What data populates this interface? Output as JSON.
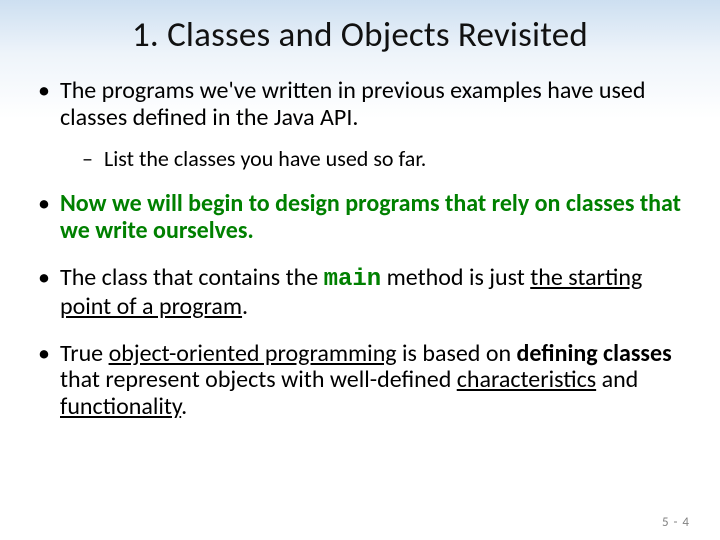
{
  "slide": {
    "title": "1. Classes and Objects Revisited",
    "bullets": {
      "b1": {
        "text": "The programs we've written in previous examples have used classes defined in the Java API.",
        "sub1": "List the classes you have used so far."
      },
      "b2": {
        "text": "Now we will begin to design programs that rely on classes that we write ourselves."
      },
      "b3": {
        "pre": "The class that contains the ",
        "code": "main",
        "mid": " method is just ",
        "u1": "the starting point of a program",
        "post": "."
      },
      "b4": {
        "t1": "True ",
        "u1": "object-oriented programming",
        "t2": " is based on ",
        "b1": "defining classes",
        "t3": " that represent objects with well-defined ",
        "u2": "characteristics",
        "t4": " and ",
        "u3": "functionality",
        "t5": "."
      }
    },
    "footer": "5 - 4"
  }
}
